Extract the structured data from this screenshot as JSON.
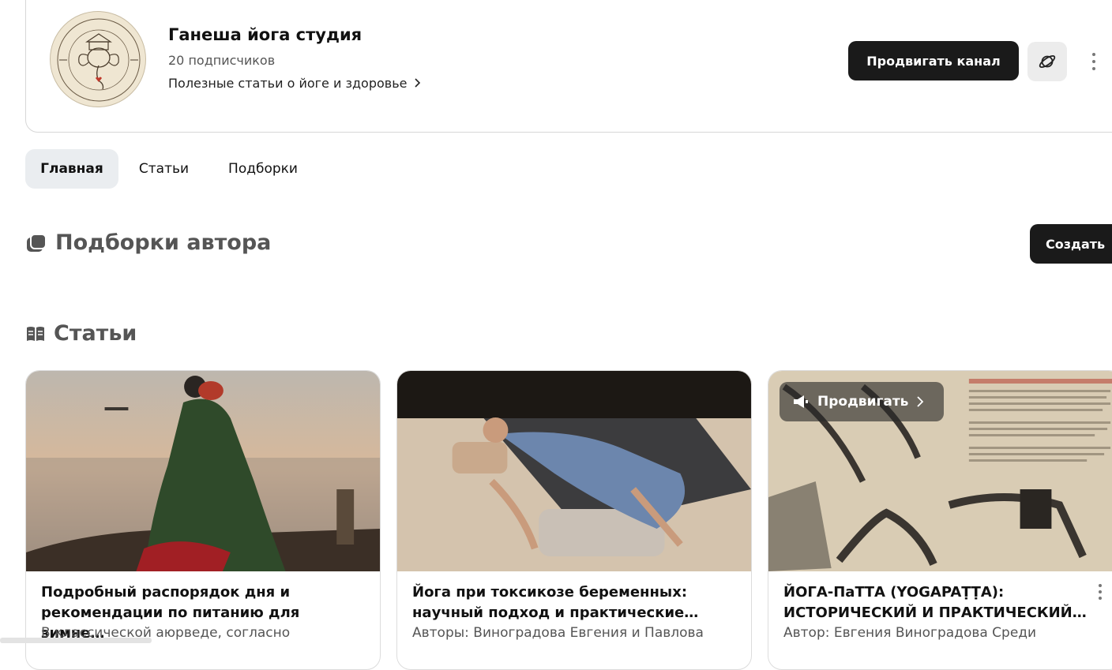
{
  "channel": {
    "name": "Ганеша йога студия",
    "subscribers": "20 подписчиков",
    "description": "Полезные статьи о йоге и здоровье",
    "promote_label": "Продвигать канал",
    "logo_text_top": "Ганеша Йога Студия",
    "logo_text_bottom": "Цели Творчество Любовь"
  },
  "tabs": [
    {
      "label": "Главная",
      "active": true
    },
    {
      "label": "Статьи",
      "active": false
    },
    {
      "label": "Подборки",
      "active": false
    }
  ],
  "sections": {
    "collections_title": "Подборки автора",
    "create_label": "Создать",
    "articles_title": "Статьи"
  },
  "articles": [
    {
      "title": "Подробный распорядок дня и рекомендации по питанию для зимне…",
      "snippet": "В классической аюрведе, согласно"
    },
    {
      "title": "Йога при токсикозе беременных: научный подход и практические…",
      "snippet": "Авторы: Виноградова Евгения и Павлова"
    },
    {
      "title": "ЙОГА-ПаТТА (YOGAPAṬṬA): ИСТОРИЧЕСКИЙ И ПРАКТИЧЕСКИЙ…",
      "snippet": "Автор: Евгения Виноградова Среди",
      "promo_label": "Продвигать"
    }
  ],
  "colors": {
    "dark_button": "#1a1a1a",
    "active_tab": "#eaedf0",
    "section_title": "#555555"
  }
}
